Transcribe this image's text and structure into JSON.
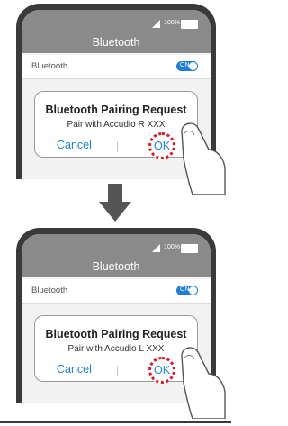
{
  "panels": [
    {
      "title": "Bluetooth",
      "battery_text": "100%",
      "setting_label": "Bluetooth",
      "toggle_text": "ON",
      "dialog": {
        "title": "Bluetooth Pairing Request",
        "message": "Pair with Accudio R XXX",
        "cancel_label": "Cancel",
        "divider": "|",
        "ok_label": "OK"
      }
    },
    {
      "title": "Bluetooth",
      "battery_text": "100%",
      "setting_label": "Bluetooth",
      "toggle_text": "ON",
      "dialog": {
        "title": "Bluetooth Pairing Request",
        "message": "Pair with Accudio L XXX",
        "cancel_label": "Cancel",
        "divider": "|",
        "ok_label": "OK"
      }
    }
  ],
  "colors": {
    "accent": "#1e7fd6",
    "highlight": "#e0141e",
    "status_bar": "#8a8a8a",
    "phone_frame": "#3a3a3a"
  }
}
